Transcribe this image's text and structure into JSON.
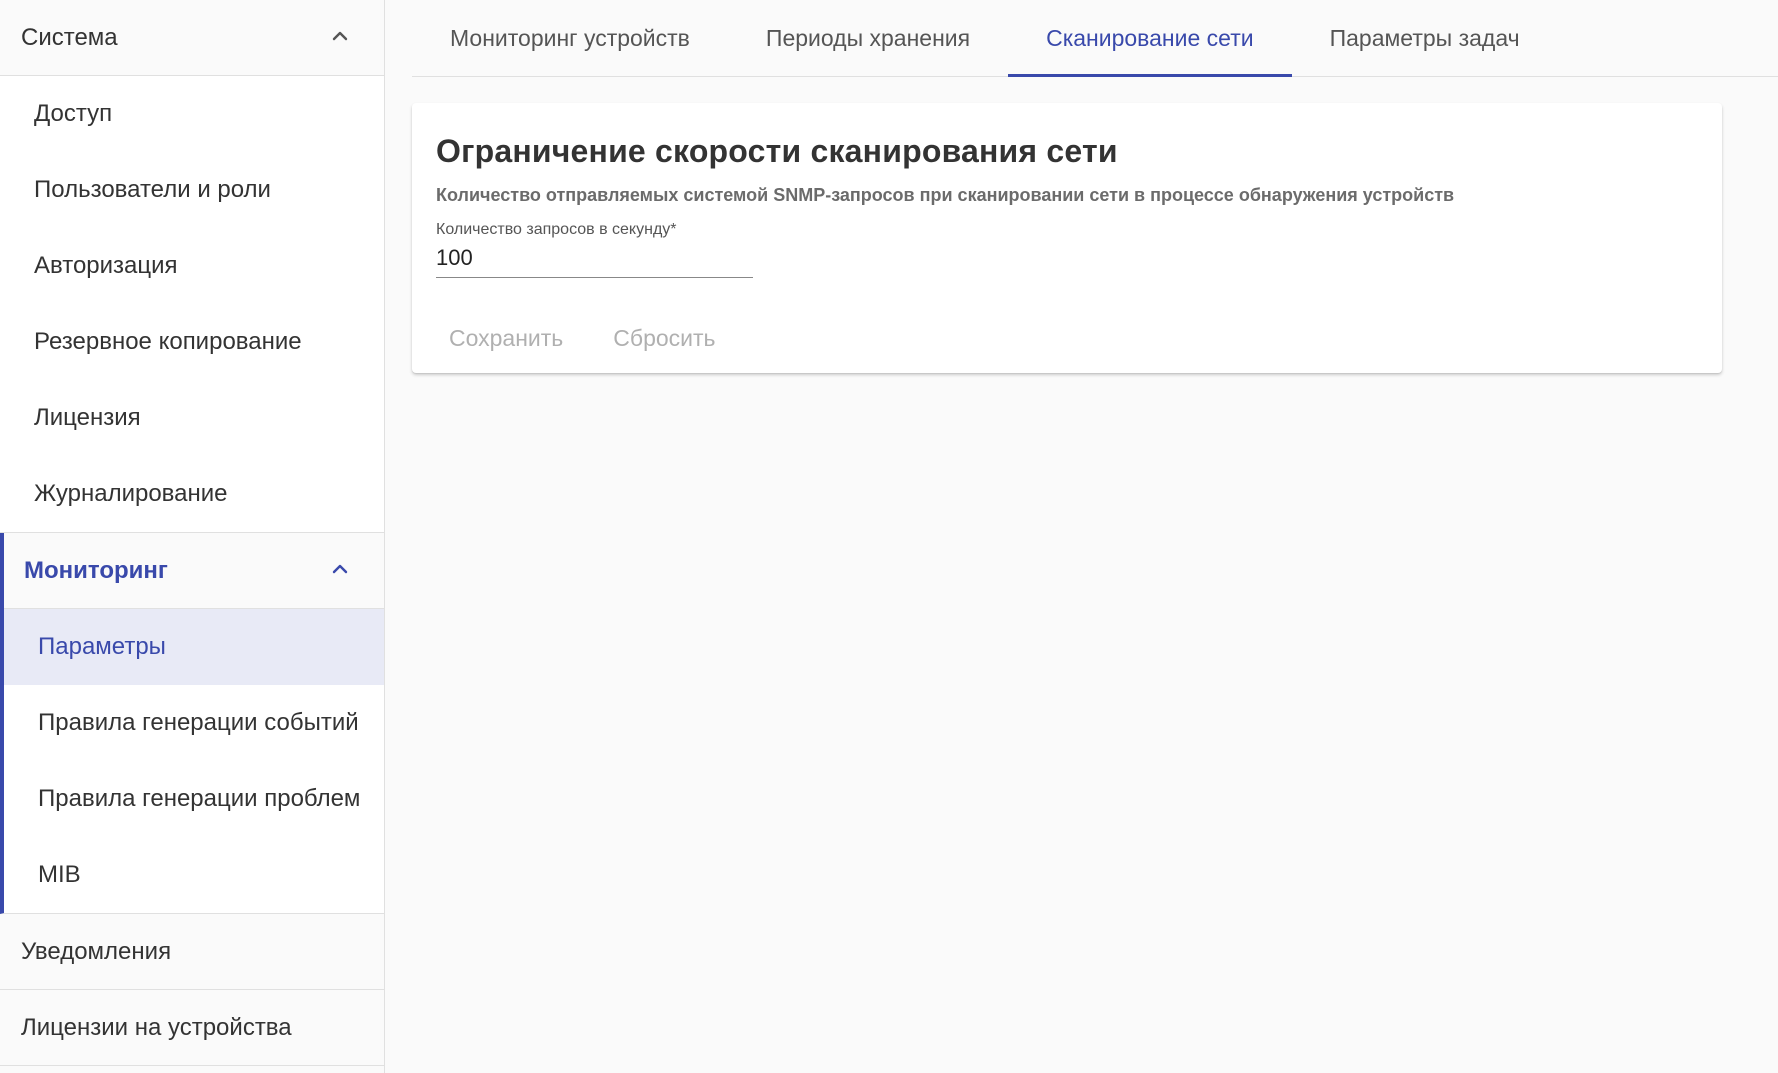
{
  "sidebar": {
    "system": {
      "label": "Система",
      "items": [
        {
          "label": "Доступ"
        },
        {
          "label": "Пользователи и роли"
        },
        {
          "label": "Авторизация"
        },
        {
          "label": "Резервное копирование"
        },
        {
          "label": "Лицензия"
        },
        {
          "label": "Журналирование"
        }
      ]
    },
    "monitoring": {
      "label": "Мониторинг",
      "items": [
        {
          "label": "Параметры",
          "selected": true
        },
        {
          "label": "Правила генерации событий"
        },
        {
          "label": "Правила генерации проблем"
        },
        {
          "label": "MIB"
        }
      ]
    },
    "notifications": {
      "label": "Уведомления"
    },
    "device_licenses": {
      "label": "Лицензии на устройства"
    }
  },
  "tabs": [
    {
      "label": "Мониторинг устройств"
    },
    {
      "label": "Периоды хранения"
    },
    {
      "label": "Сканирование сети",
      "active": true
    },
    {
      "label": "Параметры задач"
    }
  ],
  "card": {
    "title": "Ограничение скорости сканирования сети",
    "description": "Количество отправляемых системой SNMP-запросов при сканировании сети в процессе обнаружения устройств",
    "field_label": "Количество запросов в секунду*",
    "field_value": "100",
    "save_label": "Сохранить",
    "reset_label": "Сбросить"
  },
  "colors": {
    "accent": "#3949ab",
    "selected_bg": "#e8eaf6",
    "disabled_text": "#b0b0b0"
  }
}
